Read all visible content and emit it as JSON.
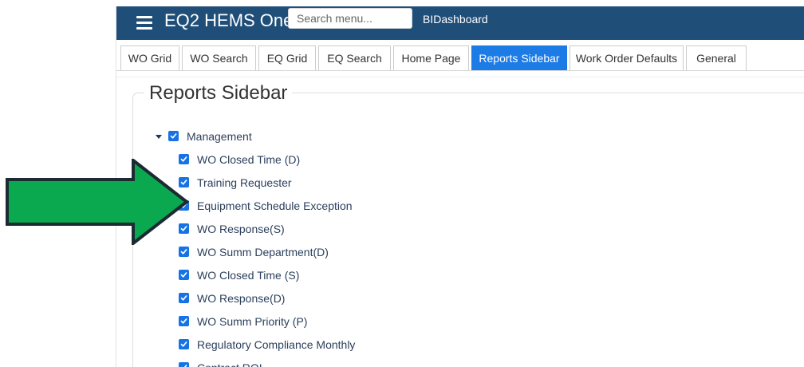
{
  "app": {
    "title": "EQ2 HEMS One",
    "search_placeholder": "Search menu...",
    "dashboard_label": "BIDashboard"
  },
  "tabs": [
    {
      "label": "WO Grid"
    },
    {
      "label": "WO Search"
    },
    {
      "label": "EQ Grid"
    },
    {
      "label": "EQ Search"
    },
    {
      "label": "Home Page"
    },
    {
      "label": "Reports Sidebar",
      "active": true
    },
    {
      "label": "Work Order Defaults"
    },
    {
      "label": "General"
    }
  ],
  "panel": {
    "title": "Reports Sidebar"
  },
  "tree": {
    "root": {
      "label": "Management",
      "expanded": true,
      "checked": true
    },
    "items": [
      {
        "label": "WO Closed Time (D)",
        "checked": true
      },
      {
        "label": "Training Requester",
        "checked": true
      },
      {
        "label": "Equipment Schedule Exception",
        "checked": true
      },
      {
        "label": "WO Response(S)",
        "checked": true
      },
      {
        "label": "WO Summ Department(D)",
        "checked": true
      },
      {
        "label": "WO Closed Time (S)",
        "checked": true
      },
      {
        "label": "WO Response(D)",
        "checked": true
      },
      {
        "label": "WO Summ Priority (P)",
        "checked": true
      },
      {
        "label": "Regulatory Compliance Monthly",
        "checked": true
      },
      {
        "label": "Contract ROI",
        "checked": true
      }
    ]
  },
  "annotation": {
    "arrow_icon": "right-arrow-icon",
    "color": "#0aa84f",
    "outline": "#1c2a33"
  },
  "colors": {
    "header": "#1f4e79",
    "active_tab": "#1d7be6",
    "checkbox": "#1673e6"
  }
}
